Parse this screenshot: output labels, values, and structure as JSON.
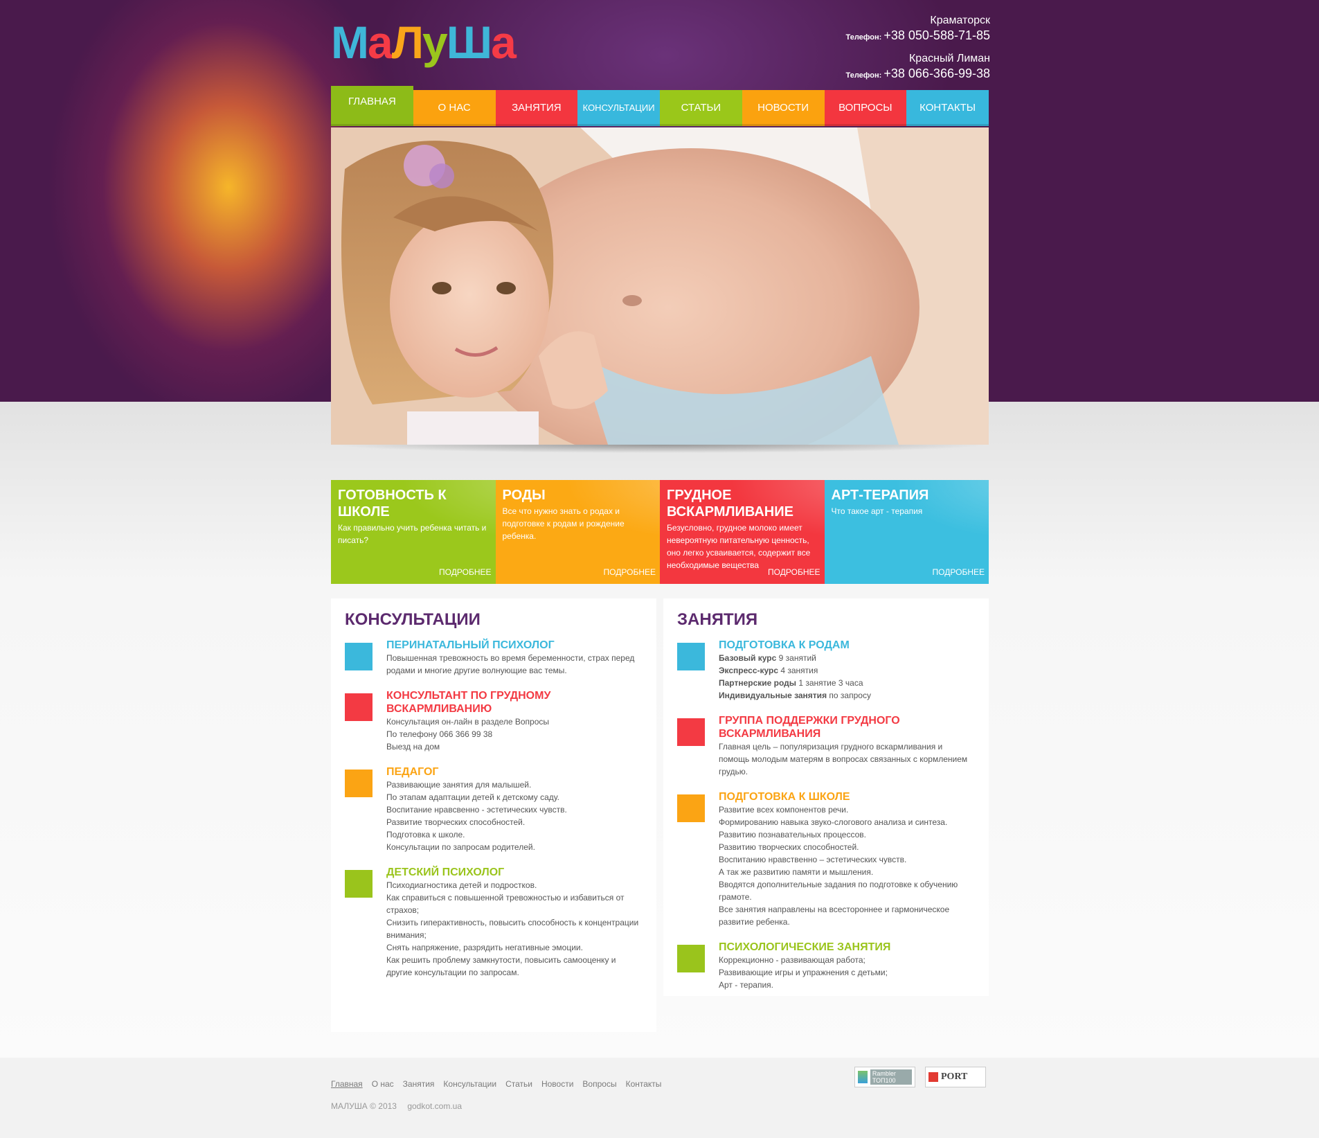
{
  "logo": {
    "letters": [
      "М",
      "а",
      "Л",
      "у",
      "Ш",
      "а"
    ],
    "colors": [
      "#3fb6d8",
      "#f53b46",
      "#f9a51a",
      "#9bc61c",
      "#3fb6d8",
      "#f53b46"
    ]
  },
  "contacts": [
    {
      "city": "Краматорск",
      "phone_label": "Телефон:",
      "phone": "+38 050-588-71-85"
    },
    {
      "city": "Красный Лиман",
      "phone_label": "Телефон:",
      "phone": "+38 066-366-99-38"
    }
  ],
  "nav": [
    {
      "label": "ГЛАВНАЯ",
      "color": "#8dbb18",
      "active": true
    },
    {
      "label": "О НАС",
      "color": "#fba20f"
    },
    {
      "label": "ЗАНЯТИЯ",
      "color": "#f3363f"
    },
    {
      "label": "КОНСУЛЬТАЦИИ",
      "color": "#38b8dd"
    },
    {
      "label": "СТАТЬИ",
      "color": "#9ac71a"
    },
    {
      "label": "НОВОСТИ",
      "color": "#fba20f"
    },
    {
      "label": "ВОПРОСЫ",
      "color": "#f3363f"
    },
    {
      "label": "КОНТАКТЫ",
      "color": "#38b8dd"
    }
  ],
  "features": [
    {
      "title": "ГОТОВНОСТЬ К ШКОЛЕ",
      "desc": "Как правильно учить ребенка читать и писать?",
      "more": "ПОДРОБНЕЕ",
      "color": "#9bc81c"
    },
    {
      "title": "РОДЫ",
      "desc": "Все что нужно знать о родах и подготовке к родам и рождение ребенка.",
      "more": "ПОДРОБНЕЕ",
      "color": "#fca914"
    },
    {
      "title": "ГРУДНОЕ ВСКАРМЛИВАНИЕ",
      "desc": "Безусловно, грудное молоко имеет невероятную питательную ценность, оно легко усваивается, содержит все необходимые вещества",
      "more": "ПОДРОБНЕЕ",
      "color": "#f3373f"
    },
    {
      "title": "АРТ-ТЕРАПИЯ",
      "desc": "Что такое арт - терапия",
      "more": "ПОДРОБНЕЕ",
      "color": "#3cbfe0"
    }
  ],
  "consultations": {
    "heading": "КОНСУЛЬТАЦИИ",
    "items": [
      {
        "title": "ПЕРИНАТАЛЬНЫЙ ПСИХОЛОГ",
        "color": "#3bb8dc",
        "lines": [
          "Повышенная тревожность во время беременности, страх перед родами и многие другие волнующие вас темы."
        ]
      },
      {
        "title": "КОНСУЛЬТАНТ ПО ГРУДНОМУ ВСКАРМЛИВАНИЮ",
        "color": "#f33a43",
        "lines": [
          "Консультация он-лайн в разделе Вопросы",
          "По телефону 066 366 99 38",
          "Выезд на дом"
        ]
      },
      {
        "title": "ПЕДАГОГ",
        "color": "#fba414",
        "lines": [
          "Развивающие занятия для малышей.",
          "По этапам адаптации детей к детскому саду.",
          "Воспитание нравсвенно - эстетических чувств.",
          "Развитие творческих способностей.",
          "Подготовка к школе.",
          "Консультации по запросам родителей."
        ]
      },
      {
        "title": "ДЕТСКИЙ ПСИХОЛОГ",
        "color": "#9ac41c",
        "lines": [
          "Психодиагностика детей и подростков.",
          "Как справиться с повышенной тревожностью и избавиться от страхов;",
          "Снизить гиперактивность, повысить способность к концентрации внимания;",
          "Снять напряжение, разрядить негативные эмоции.",
          "Как решить проблему замкнутости, повысить самооценку и другие консультации по запросам."
        ]
      }
    ]
  },
  "classes": {
    "heading": "ЗАНЯТИЯ",
    "items": [
      {
        "title": "ПОДГОТОВКА К РОДАМ",
        "color": "#3bb8dc",
        "rich": [
          [
            "Базовый курс",
            " 9 занятий"
          ],
          [
            "Экспресс-курс",
            " 4 занятия"
          ],
          [
            "Партнерские роды",
            " 1 занятие 3 часа"
          ],
          [
            "Индивидуальные занятия",
            " по запросу"
          ]
        ]
      },
      {
        "title": "ГРУППА ПОДДЕРЖКИ ГРУДНОГО ВСКАРМЛИВАНИЯ",
        "color": "#f33a43",
        "lines": [
          "Главная цель – популяризация грудного вскармливания и помощь молодым матерям в вопросах связанных с кормлением грудью."
        ]
      },
      {
        "title": "ПОДГОТОВКА К ШКОЛЕ",
        "color": "#fba414",
        "lines": [
          "Развитие всех компонентов речи.",
          "Формированию навыка звуко-слогового анализа и синтеза.",
          "Развитию познавательных процессов.",
          "Развитию творческих способностей.",
          "Воспитанию нравственно – эстетических чувств.",
          "А так же развитию памяти и мышления.",
          "Вводятся  дополнительные задания по подготовке к обучению грамоте.",
          "Все занятия направлены на всестороннее и гармоническое развитие  ребенка."
        ]
      },
      {
        "title": "ПСИХОЛОГИЧЕСКИЕ ЗАНЯТИЯ",
        "color": "#9ac41c",
        "lines": [
          "Коррекционно - развивающая работа;",
          "Развивающие игры и упражнения с детьми;",
          "Арт - терапия."
        ]
      }
    ]
  },
  "footer": {
    "links": [
      "Главная",
      "О нас",
      "Занятия",
      "Консультации",
      "Статьи",
      "Новости",
      "Вопросы",
      "Контакты"
    ],
    "copyright": "МАЛУША  © 2013",
    "site": "godkot.com.ua",
    "badge1": "Rambler ТОП100",
    "badge2": "PORT"
  }
}
